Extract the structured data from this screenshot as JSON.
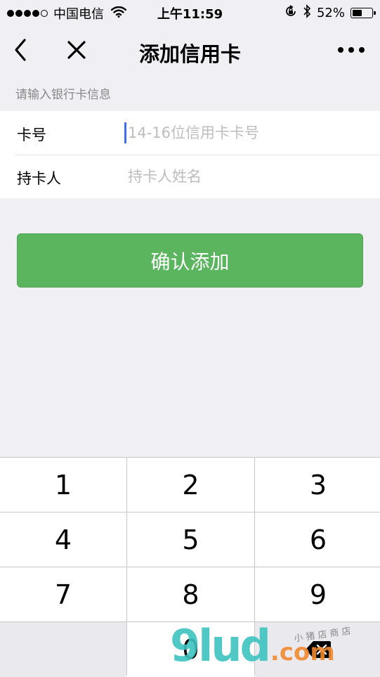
{
  "status_bar": {
    "carrier": "中国电信",
    "time": "上午11:59",
    "battery_percent": "52%",
    "battery_level": 0.52,
    "icons": [
      "signal-dots",
      "wifi-icon",
      "orientation-lock-icon",
      "bluetooth-icon",
      "battery-icon"
    ]
  },
  "nav": {
    "title": "添加信用卡",
    "icons": [
      "back-icon",
      "close-icon",
      "more-icon"
    ]
  },
  "form": {
    "section_hint": "请输入银行卡信息",
    "card_number": {
      "label": "卡号",
      "value": "",
      "placeholder": "14-16位信用卡卡号"
    },
    "cardholder": {
      "label": "持卡人",
      "value": "",
      "placeholder": "持卡人姓名"
    }
  },
  "confirm_button": {
    "label": "确认添加",
    "color": "#5ab55e"
  },
  "keypad": {
    "keys": [
      "1",
      "2",
      "3",
      "4",
      "5",
      "6",
      "7",
      "8",
      "9",
      "0"
    ],
    "delete_icon": "backspace-icon"
  },
  "watermark": {
    "main": "9lud",
    "suffix": ".com",
    "sub": "小 猪 店 商 店"
  }
}
